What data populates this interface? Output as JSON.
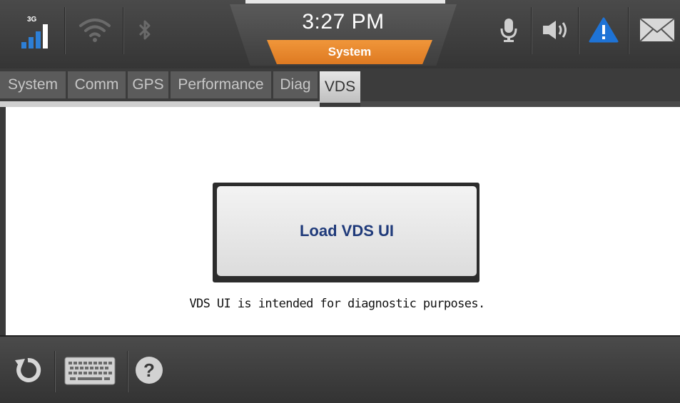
{
  "status_bar": {
    "network_type": "3G",
    "clock": {
      "time": "3:27 PM",
      "app": "System"
    },
    "icons": [
      "cellular-signal-icon",
      "wifi-icon",
      "bluetooth-icon",
      "microphone-icon",
      "speaker-icon",
      "alert-icon",
      "mail-icon"
    ],
    "colors": {
      "signal": "#2d7fd6",
      "alert": "#1e73d6",
      "accent": "#e8832c"
    }
  },
  "tabs": [
    {
      "label": "System"
    },
    {
      "label": "Comm"
    },
    {
      "label": "GPS"
    },
    {
      "label": "Performance"
    },
    {
      "label": "Diag"
    },
    {
      "label": "VDS"
    }
  ],
  "active_tab": "VDS",
  "content": {
    "load_button_label": "Load VDS UI",
    "description": "VDS UI is intended for diagnostic purposes."
  },
  "bottom_bar": {
    "buttons": [
      "refresh-icon",
      "keyboard-icon",
      "help-icon"
    ],
    "help_glyph": "?"
  }
}
